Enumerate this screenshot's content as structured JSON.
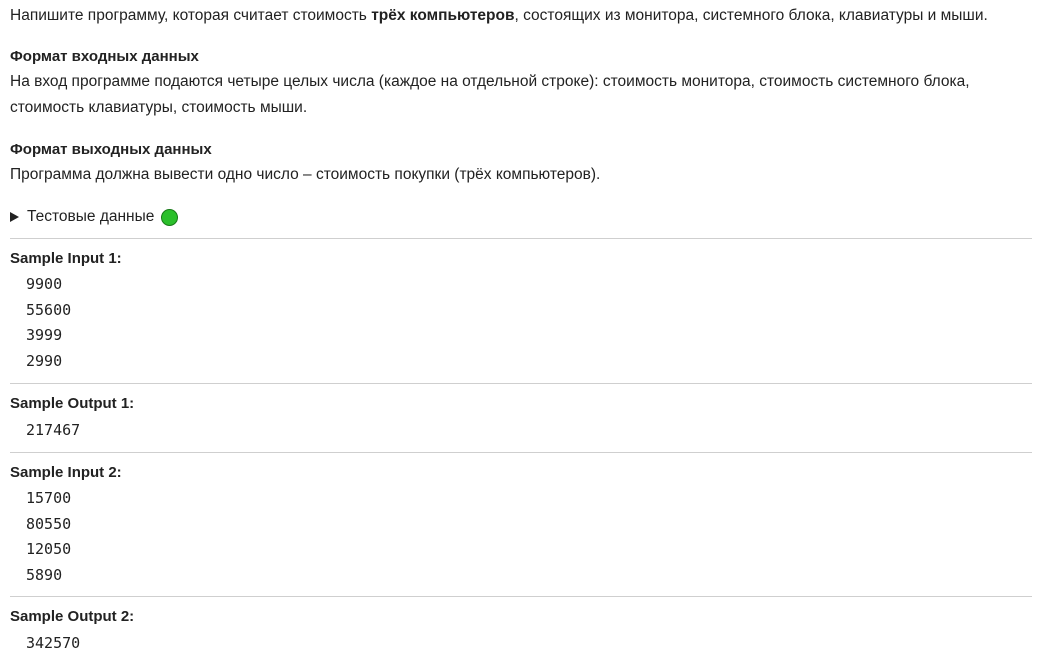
{
  "statement": {
    "intro_before": "Напишите программу, которая считает стоимость ",
    "intro_bold": "трёх компьютеров",
    "intro_after": ", состоящих из монитора, системного блока, клавиатуры и мыши."
  },
  "input_format": {
    "title": "Формат входных данных",
    "text": "На вход программе подаются четыре целых числа (каждое на отдельной строке): стоимость монитора, стоимость системного блока, стоимость клавиатуры, стоимость мыши."
  },
  "output_format": {
    "title": "Формат выходных данных",
    "text": "Программа должна вывести одно число – стоимость покупки (трёх компьютеров)."
  },
  "test_data": {
    "label": "Тестовые данные",
    "status_color": "#2bbf2b"
  },
  "samples": [
    {
      "label": "Sample Input 1:",
      "lines": [
        "9900",
        "55600",
        "3999",
        "2990"
      ]
    },
    {
      "label": "Sample Output 1:",
      "lines": [
        "217467"
      ]
    },
    {
      "label": "Sample Input 2:",
      "lines": [
        "15700",
        "80550",
        "12050",
        "5890"
      ]
    },
    {
      "label": "Sample Output 2:",
      "lines": [
        "342570"
      ]
    }
  ]
}
